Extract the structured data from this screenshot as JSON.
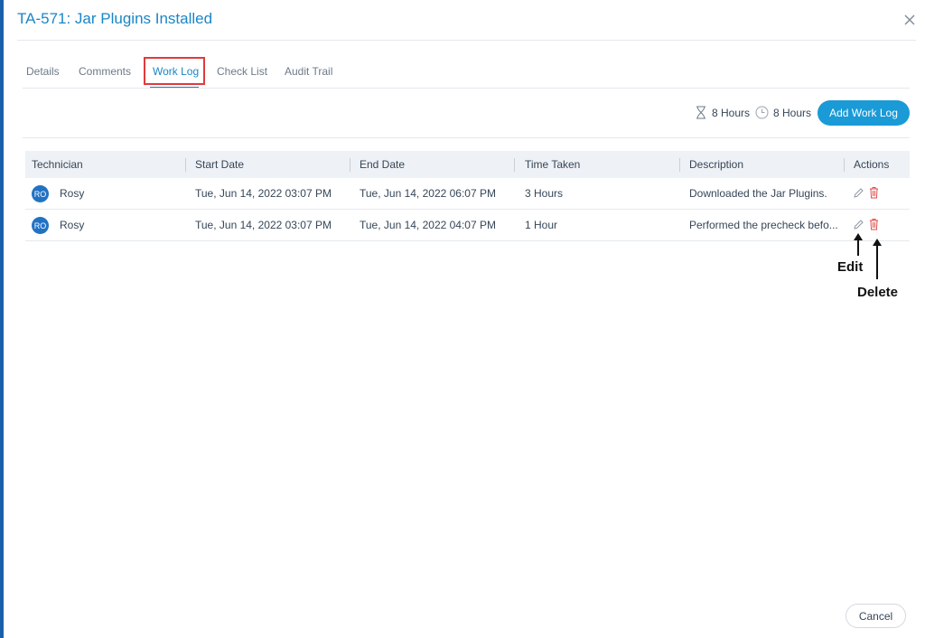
{
  "modal": {
    "title": "TA-571: Jar Plugins Installed"
  },
  "tabs": [
    "Details",
    "Comments",
    "Work Log",
    "Check List",
    "Audit Trail"
  ],
  "active_tab": "Work Log",
  "summary": {
    "estimated": "8 Hours",
    "actual": "8 Hours"
  },
  "add_button_label": "Add Work Log",
  "table": {
    "headers": [
      "Technician",
      "Start Date",
      "End Date",
      "Time Taken",
      "Description",
      "Actions"
    ],
    "rows": [
      {
        "avatar": "RO",
        "technician": "Rosy",
        "start": "Tue, Jun 14, 2022 03:07 PM",
        "end": "Tue, Jun 14, 2022 06:07 PM",
        "time": "3 Hours",
        "description": "Downloaded the Jar Plugins."
      },
      {
        "avatar": "RO",
        "technician": "Rosy",
        "start": "Tue, Jun 14, 2022 03:07 PM",
        "end": "Tue, Jun 14, 2022 04:07 PM",
        "time": "1 Hour",
        "description": "Performed the precheck befo..."
      }
    ]
  },
  "annotations": {
    "edit": "Edit",
    "delete": "Delete"
  },
  "cancel_label": "Cancel",
  "colors": {
    "accent": "#1a86c7",
    "button": "#1a9ad6",
    "highlight": "#e03b3b",
    "delete": "#e04b4b"
  },
  "icons": {
    "close": "close-icon",
    "hourglass": "hourglass-icon",
    "clock": "clock-icon",
    "edit": "pencil-icon",
    "delete": "trash-icon"
  }
}
